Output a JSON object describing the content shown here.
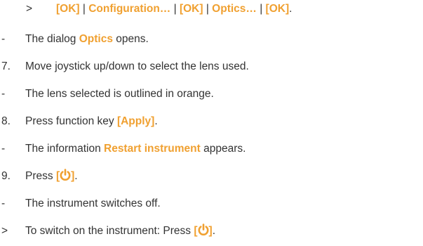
{
  "lines": [
    {
      "marker": ">",
      "parts": [
        "[OK]",
        " | ",
        "Configuration…",
        " | ",
        "[OK]",
        " | ",
        "Optics…",
        " | ",
        "[OK]",
        "."
      ]
    },
    {
      "marker": "-",
      "parts": [
        "The dialog ",
        "Optics",
        " opens."
      ]
    },
    {
      "marker": "7.",
      "parts": [
        "Move joystick up/down to select the lens used."
      ]
    },
    {
      "marker": "-",
      "parts": [
        "The lens selected is outlined in orange."
      ]
    },
    {
      "marker": "8.",
      "parts": [
        "Press function key ",
        "[Apply]",
        "."
      ]
    },
    {
      "marker": "-",
      "parts": [
        "The information ",
        "Restart instrument",
        " appears."
      ]
    },
    {
      "marker": "9.",
      "parts": [
        "Press ",
        "[",
        "]",
        "."
      ]
    },
    {
      "marker": "-",
      "parts": [
        "The instrument switches off."
      ]
    },
    {
      "marker": ">",
      "parts": [
        "To switch on the instrument: Press ",
        "[",
        "]",
        "."
      ]
    }
  ],
  "colors": {
    "highlight": "#f0a030",
    "text": "#333333"
  },
  "icons": {
    "power": "power-icon"
  }
}
